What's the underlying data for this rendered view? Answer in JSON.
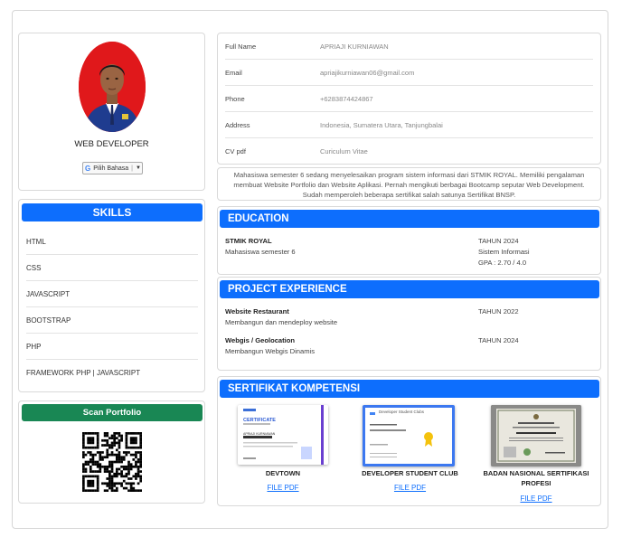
{
  "profile": {
    "role": "WEB DEVELOPER",
    "language_button": "Pilih Bahasa",
    "language_arrow": "▼"
  },
  "skills": {
    "title": "SKILLS",
    "items": [
      "HTML",
      "CSS",
      "JAVASCRIPT",
      "BOOTSTRAP",
      "PHP",
      "FRAMEWORK PHP | JAVASCRIPT"
    ]
  },
  "scan": {
    "title": "Scan Portfolio"
  },
  "info": {
    "rows": [
      {
        "label": "Full Name",
        "value": "APRIAJI KURNIAWAN"
      },
      {
        "label": "Email",
        "value": "apriajikurniawan06@gmail.com"
      },
      {
        "label": "Phone",
        "value": "+6283874424867"
      },
      {
        "label": "Address",
        "value": "Indonesia, Sumatera Utara, Tanjungbalai"
      },
      {
        "label": "CV pdf",
        "value": "Curiculum Vitae"
      }
    ]
  },
  "about": "Mahasiswa semester 6 sedang menyelesaikan program sistem informasi dari STMIK ROYAL. Memiliki pengalaman membuat Website Portfolio dan Website Aplikasi. Pernah mengikuti berbagai Bootcamp seputar Web Development. Sudah memperoleh beberapa sertifikat salah satunya Sertifikat BNSP.",
  "education": {
    "title": "EDUCATION",
    "school": "STMIK ROYAL",
    "status": "Mahasiswa semester 6",
    "year": "TAHUN 2024",
    "major": "Sistem Informasi",
    "gpa": "GPA : 2.70 / 4.0"
  },
  "projects": {
    "title": "PROJECT EXPERIENCE",
    "items": [
      {
        "name": "Website Restaurant",
        "desc": "Membangun dan mendeploy website",
        "year": "TAHUN 2022"
      },
      {
        "name": "Webgis / Geolocation",
        "desc": "Membangun Webgis Dinamis",
        "year": "TAHUN 2024"
      }
    ]
  },
  "certificates": {
    "title": "SERTIFIKAT KOMPETENSI",
    "items": [
      {
        "name": "DEVTOWN",
        "link": "FILE PDF",
        "img_title": "CERTIFICATE",
        "img_sub": "APRIAJI KURNIAWAN"
      },
      {
        "name": "DEVELOPER STUDENT CLUB",
        "link": "FILE PDF",
        "img_title": "Developer Student Clubs"
      },
      {
        "name": "BADAN NASIONAL SERTIFIKASI PROFESI",
        "link": "FILE PDF"
      }
    ]
  },
  "colors": {
    "primary": "#0d6efd",
    "success": "#198754",
    "photo_bg": "#e0181b"
  }
}
